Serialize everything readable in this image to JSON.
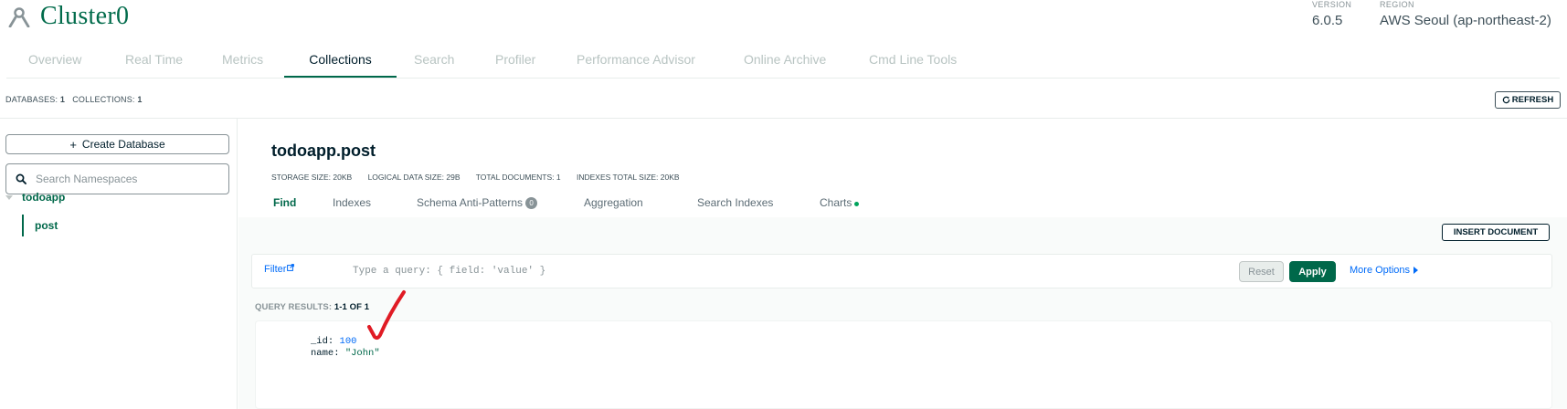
{
  "header": {
    "cluster_name": "Cluster0",
    "version_label": "VERSION",
    "version_value": "6.0.5",
    "region_label": "REGION",
    "region_value": "AWS Seoul (ap-northeast-2)"
  },
  "top_tabs": [
    {
      "label": "Overview",
      "active": false
    },
    {
      "label": "Real Time",
      "active": false
    },
    {
      "label": "Metrics",
      "active": false
    },
    {
      "label": "Collections",
      "active": true
    },
    {
      "label": "Search",
      "active": false
    },
    {
      "label": "Profiler",
      "active": false
    },
    {
      "label": "Performance Advisor",
      "active": false
    },
    {
      "label": "Online Archive",
      "active": false
    },
    {
      "label": "Cmd Line Tools",
      "active": false
    }
  ],
  "stats_bar": {
    "databases_label": "DATABASES:",
    "databases_count": "1",
    "collections_label": "COLLECTIONS:",
    "collections_count": "1",
    "refresh_label": "REFRESH"
  },
  "sidebar": {
    "create_db_label": "Create Database",
    "search_placeholder": "Search Namespaces",
    "database": "todoapp",
    "collection": "post"
  },
  "collection": {
    "title": "todoapp.post",
    "stats": [
      "STORAGE SIZE: 20KB",
      "LOGICAL DATA SIZE: 29B",
      "TOTAL DOCUMENTS: 1",
      "INDEXES TOTAL SIZE: 20KB"
    ],
    "tabs": [
      {
        "label": "Find",
        "active": true
      },
      {
        "label": "Indexes",
        "active": false
      },
      {
        "label": "Schema Anti-Patterns",
        "badge": "0",
        "active": false
      },
      {
        "label": "Aggregation",
        "active": false
      },
      {
        "label": "Search Indexes",
        "active": false
      },
      {
        "label": "Charts",
        "active": false
      }
    ]
  },
  "find": {
    "insert_label": "INSERT DOCUMENT",
    "filter_label": "Filter",
    "query_placeholder": "Type a query: { field: 'value' }",
    "reset_label": "Reset",
    "apply_label": "Apply",
    "more_options_label": "More Options",
    "results_label": "QUERY RESULTS:",
    "results_count": "1-1 OF 1"
  },
  "document": {
    "fields": [
      {
        "key": "_id:",
        "value": "100",
        "type": "number"
      },
      {
        "key": "name:",
        "value": "\"John\"",
        "type": "string"
      }
    ]
  },
  "colors": {
    "brand_green": "#00684a",
    "link_blue": "#016bf8",
    "annotation_red": "#e01b24"
  },
  "icons": [
    "cluster-icon",
    "external-link-icon",
    "refresh-icon",
    "plus-icon",
    "search-icon",
    "caret-down-icon",
    "caret-right-icon",
    "checkmark-annotation"
  ]
}
